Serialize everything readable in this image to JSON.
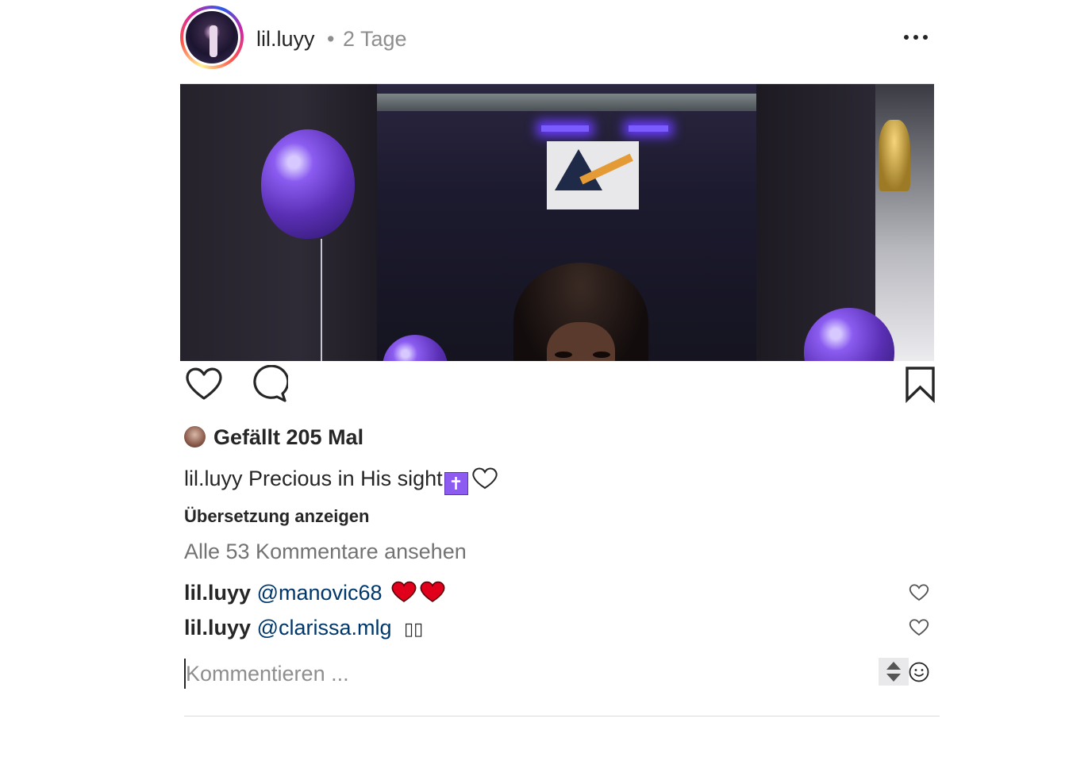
{
  "post": {
    "username": "lil.luyy",
    "separator": "•",
    "time_ago": "2 Tage",
    "likes_text": "Gefällt 205 Mal",
    "caption_username": "lil.luyy",
    "caption_text": "Precious in His sight",
    "caption_emoji_cross": "✝",
    "translate_label": "Übersetzung anzeigen",
    "view_all_comments": "Alle 53 Kommentare ansehen",
    "comments": [
      {
        "username": "lil.luyy",
        "mention": "@manovic68",
        "trailing": ""
      },
      {
        "username": "lil.luyy",
        "mention": "@clarissa.mlg",
        "trailing": "▯▯"
      }
    ],
    "comment_placeholder": "Kommentieren ..."
  },
  "icons": {
    "more": "more-horizontal-icon",
    "like": "heart-outline-icon",
    "comment": "comment-bubble-icon",
    "save": "bookmark-icon",
    "emoji": "smiley-icon"
  },
  "colors": {
    "text": "#262626",
    "secondary": "#8e8e8e",
    "mention": "#00376b",
    "heart_red": "#e0001b"
  }
}
